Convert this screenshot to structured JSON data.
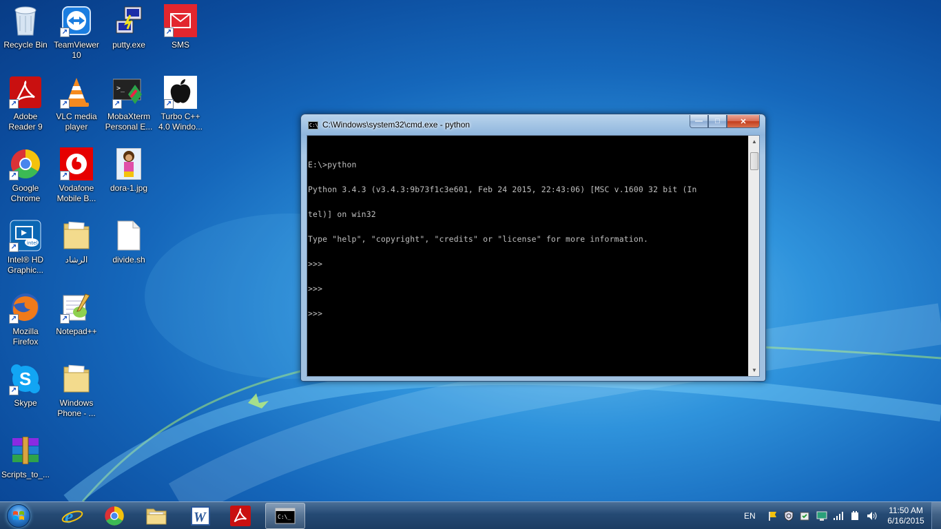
{
  "desktop": {
    "icons": [
      {
        "label": "Recycle Bin"
      },
      {
        "label": "TeamViewer 10"
      },
      {
        "label": "putty.exe"
      },
      {
        "label": "SMS"
      },
      {
        "label": "Adobe Reader 9"
      },
      {
        "label": "VLC media player"
      },
      {
        "label": "MobaXterm Personal E..."
      },
      {
        "label": "Turbo C++ 4.0 Windo..."
      },
      {
        "label": "Google Chrome"
      },
      {
        "label": "Vodafone Mobile B..."
      },
      {
        "label": "dora-1.jpg"
      },
      {
        "label": "Intel® HD Graphic..."
      },
      {
        "label": "الرشاد"
      },
      {
        "label": "divide.sh"
      },
      {
        "label": "Mozilla Firefox"
      },
      {
        "label": "Notepad++"
      },
      {
        "label": "Skype"
      },
      {
        "label": "Windows Phone - ..."
      },
      {
        "label": "Scripts_to_..."
      }
    ]
  },
  "cmd_window": {
    "title": "C:\\Windows\\system32\\cmd.exe - python",
    "icon_text": "C:\\",
    "controls": {
      "minimize": "—",
      "maximize": "□",
      "close": "✕"
    },
    "console_lines": [
      "E:\\>python",
      "Python 3.4.3 (v3.4.3:9b73f1c3e601, Feb 24 2015, 22:43:06) [MSC v.1600 32 bit (In",
      "tel)] on win32",
      "Type \"help\", \"copyright\", \"credits\" or \"license\" for more information.",
      ">>>",
      ">>>",
      ">>>"
    ]
  },
  "taskbar": {
    "pinned": [
      "Internet Explorer",
      "Google Chrome",
      "Windows Explorer",
      "Microsoft Word",
      "Adobe Reader"
    ],
    "running": [
      "Command Prompt"
    ],
    "language": "EN",
    "clock": {
      "time": "11:50 AM",
      "date": "6/16/2015"
    }
  },
  "colors": {
    "console_bg": "#000000",
    "console_fg": "#c0c0c0",
    "close_button": "#c33d1c",
    "desktop_blue": "#1567bb"
  }
}
